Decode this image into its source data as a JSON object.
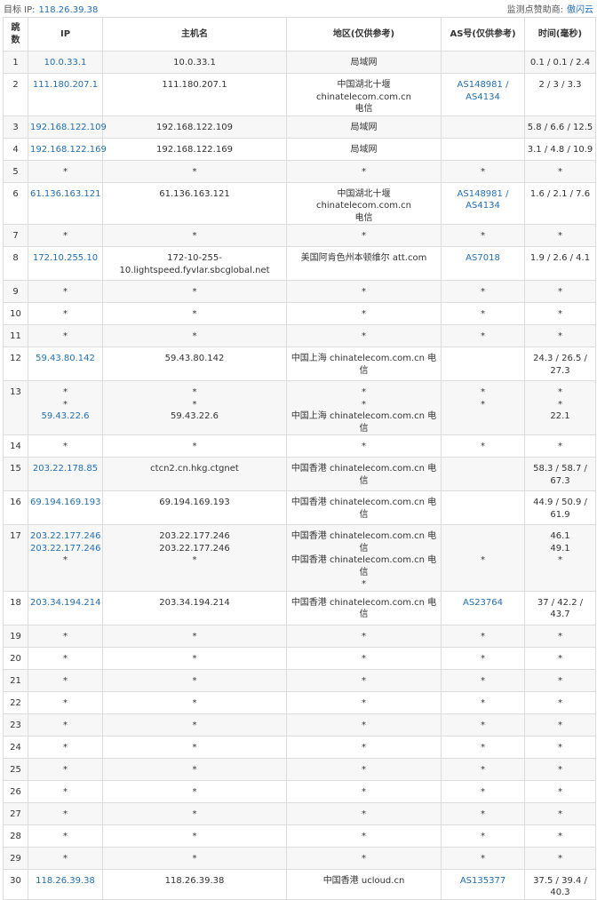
{
  "header": {
    "target_label": "目标 IP:",
    "target_ip": "118.26.39.38",
    "sponsor_label": "监测点赞助商:",
    "sponsor_name": "傲闪云"
  },
  "table": {
    "columns": [
      "跳数",
      "IP",
      "主机名",
      "地区(仅供参考)",
      "AS号(仅供参考)",
      "时间(毫秒)"
    ],
    "rows": [
      {
        "hop": "1",
        "ip": [
          "10.0.33.1"
        ],
        "host": [
          "10.0.33.1"
        ],
        "region": [
          "局域网"
        ],
        "asn": [],
        "time": [
          "0.1 / 0.1 / 2.4"
        ]
      },
      {
        "hop": "2",
        "ip": [
          "111.180.207.1"
        ],
        "host": [
          "111.180.207.1"
        ],
        "region": [
          "中国湖北十堰 chinatelecom.com.cn",
          "电信"
        ],
        "asn": [
          "AS148981 /",
          "AS4134"
        ],
        "time": [
          "2 / 3 / 3.3"
        ]
      },
      {
        "hop": "3",
        "ip": [
          "192.168.122.109"
        ],
        "host": [
          "192.168.122.109"
        ],
        "region": [
          "局域网"
        ],
        "asn": [],
        "time": [
          "5.8 / 6.6 / 12.5"
        ]
      },
      {
        "hop": "4",
        "ip": [
          "192.168.122.169"
        ],
        "host": [
          "192.168.122.169"
        ],
        "region": [
          "局域网"
        ],
        "asn": [],
        "time": [
          "3.1 / 4.8 / 10.9"
        ]
      },
      {
        "hop": "5",
        "ip": [
          "*"
        ],
        "host": [
          "*"
        ],
        "region": [
          "*"
        ],
        "asn": [
          "*"
        ],
        "time": [
          "*"
        ]
      },
      {
        "hop": "6",
        "ip": [
          "61.136.163.121"
        ],
        "host": [
          "61.136.163.121"
        ],
        "region": [
          "中国湖北十堰 chinatelecom.com.cn",
          "电信"
        ],
        "asn": [
          "AS148981 /",
          "AS4134"
        ],
        "time": [
          "1.6 / 2.1 / 7.6"
        ]
      },
      {
        "hop": "7",
        "ip": [
          "*"
        ],
        "host": [
          "*"
        ],
        "region": [
          "*"
        ],
        "asn": [
          "*"
        ],
        "time": [
          "*"
        ]
      },
      {
        "hop": "8",
        "ip": [
          "172.10.255.10"
        ],
        "host": [
          "172-10-255-",
          "10.lightspeed.fyvlar.sbcglobal.net"
        ],
        "region": [
          "美国阿肯色州本顿维尔 att.com"
        ],
        "asn": [
          "AS7018"
        ],
        "time": [
          "1.9 / 2.6 / 4.1"
        ]
      },
      {
        "hop": "9",
        "ip": [
          "*"
        ],
        "host": [
          "*"
        ],
        "region": [
          "*"
        ],
        "asn": [
          "*"
        ],
        "time": [
          "*"
        ]
      },
      {
        "hop": "10",
        "ip": [
          "*"
        ],
        "host": [
          "*"
        ],
        "region": [
          "*"
        ],
        "asn": [
          "*"
        ],
        "time": [
          "*"
        ]
      },
      {
        "hop": "11",
        "ip": [
          "*"
        ],
        "host": [
          "*"
        ],
        "region": [
          "*"
        ],
        "asn": [
          "*"
        ],
        "time": [
          "*"
        ]
      },
      {
        "hop": "12",
        "ip": [
          "59.43.80.142"
        ],
        "host": [
          "59.43.80.142"
        ],
        "region": [
          "中国上海 chinatelecom.com.cn 电信"
        ],
        "asn": [],
        "time": [
          "24.3 / 26.5 /",
          "27.3"
        ]
      },
      {
        "hop": "13",
        "ip": [
          "*",
          "*",
          "59.43.22.6"
        ],
        "host": [
          "*",
          "*",
          "59.43.22.6"
        ],
        "region": [
          "*",
          "*",
          "中国上海 chinatelecom.com.cn 电信"
        ],
        "asn": [
          "*",
          "*",
          ""
        ],
        "time": [
          "*",
          "*",
          "22.1"
        ]
      },
      {
        "hop": "14",
        "ip": [
          "*"
        ],
        "host": [
          "*"
        ],
        "region": [
          "*"
        ],
        "asn": [
          "*"
        ],
        "time": [
          "*"
        ]
      },
      {
        "hop": "15",
        "ip": [
          "203.22.178.85"
        ],
        "host": [
          "ctcn2.cn.hkg.ctgnet"
        ],
        "region": [
          "中国香港 chinatelecom.com.cn 电信"
        ],
        "asn": [],
        "time": [
          "58.3 / 58.7 /",
          "67.3"
        ]
      },
      {
        "hop": "16",
        "ip": [
          "69.194.169.193"
        ],
        "host": [
          "69.194.169.193"
        ],
        "region": [
          "中国香港 chinatelecom.com.cn 电信"
        ],
        "asn": [],
        "time": [
          "44.9 / 50.9 /",
          "61.9"
        ]
      },
      {
        "hop": "17",
        "ip": [
          "203.22.177.246",
          "203.22.177.246",
          "*"
        ],
        "host": [
          "203.22.177.246",
          "203.22.177.246",
          "*"
        ],
        "region": [
          "中国香港 chinatelecom.com.cn 电信",
          "中国香港 chinatelecom.com.cn 电信",
          "*"
        ],
        "asn": [
          "",
          "",
          "*"
        ],
        "time": [
          "46.1",
          "49.1",
          "*"
        ]
      },
      {
        "hop": "18",
        "ip": [
          "203.34.194.214"
        ],
        "host": [
          "203.34.194.214"
        ],
        "region": [
          "中国香港 chinatelecom.com.cn 电信"
        ],
        "asn": [
          "AS23764"
        ],
        "time": [
          "37 / 42.2 /",
          "43.7"
        ]
      },
      {
        "hop": "19",
        "ip": [
          "*"
        ],
        "host": [
          "*"
        ],
        "region": [
          "*"
        ],
        "asn": [
          "*"
        ],
        "time": [
          "*"
        ]
      },
      {
        "hop": "20",
        "ip": [
          "*"
        ],
        "host": [
          "*"
        ],
        "region": [
          "*"
        ],
        "asn": [
          "*"
        ],
        "time": [
          "*"
        ]
      },
      {
        "hop": "21",
        "ip": [
          "*"
        ],
        "host": [
          "*"
        ],
        "region": [
          "*"
        ],
        "asn": [
          "*"
        ],
        "time": [
          "*"
        ]
      },
      {
        "hop": "22",
        "ip": [
          "*"
        ],
        "host": [
          "*"
        ],
        "region": [
          "*"
        ],
        "asn": [
          "*"
        ],
        "time": [
          "*"
        ]
      },
      {
        "hop": "23",
        "ip": [
          "*"
        ],
        "host": [
          "*"
        ],
        "region": [
          "*"
        ],
        "asn": [
          "*"
        ],
        "time": [
          "*"
        ]
      },
      {
        "hop": "24",
        "ip": [
          "*"
        ],
        "host": [
          "*"
        ],
        "region": [
          "*"
        ],
        "asn": [
          "*"
        ],
        "time": [
          "*"
        ]
      },
      {
        "hop": "25",
        "ip": [
          "*"
        ],
        "host": [
          "*"
        ],
        "region": [
          "*"
        ],
        "asn": [
          "*"
        ],
        "time": [
          "*"
        ]
      },
      {
        "hop": "26",
        "ip": [
          "*"
        ],
        "host": [
          "*"
        ],
        "region": [
          "*"
        ],
        "asn": [
          "*"
        ],
        "time": [
          "*"
        ]
      },
      {
        "hop": "27",
        "ip": [
          "*"
        ],
        "host": [
          "*"
        ],
        "region": [
          "*"
        ],
        "asn": [
          "*"
        ],
        "time": [
          "*"
        ]
      },
      {
        "hop": "28",
        "ip": [
          "*"
        ],
        "host": [
          "*"
        ],
        "region": [
          "*"
        ],
        "asn": [
          "*"
        ],
        "time": [
          "*"
        ]
      },
      {
        "hop": "29",
        "ip": [
          "*"
        ],
        "host": [
          "*"
        ],
        "region": [
          "*"
        ],
        "asn": [
          "*"
        ],
        "time": [
          "*"
        ]
      },
      {
        "hop": "30",
        "ip": [
          "118.26.39.38"
        ],
        "host": [
          "118.26.39.38"
        ],
        "region": [
          "中国香港 ucloud.cn"
        ],
        "asn": [
          "AS135377"
        ],
        "time": [
          "37.5 / 39.4 /",
          "40.3"
        ]
      }
    ]
  },
  "colors": {
    "link": "#1e6fb8",
    "row_alt": "#f7f7f7",
    "border": "#dcdcdc"
  }
}
